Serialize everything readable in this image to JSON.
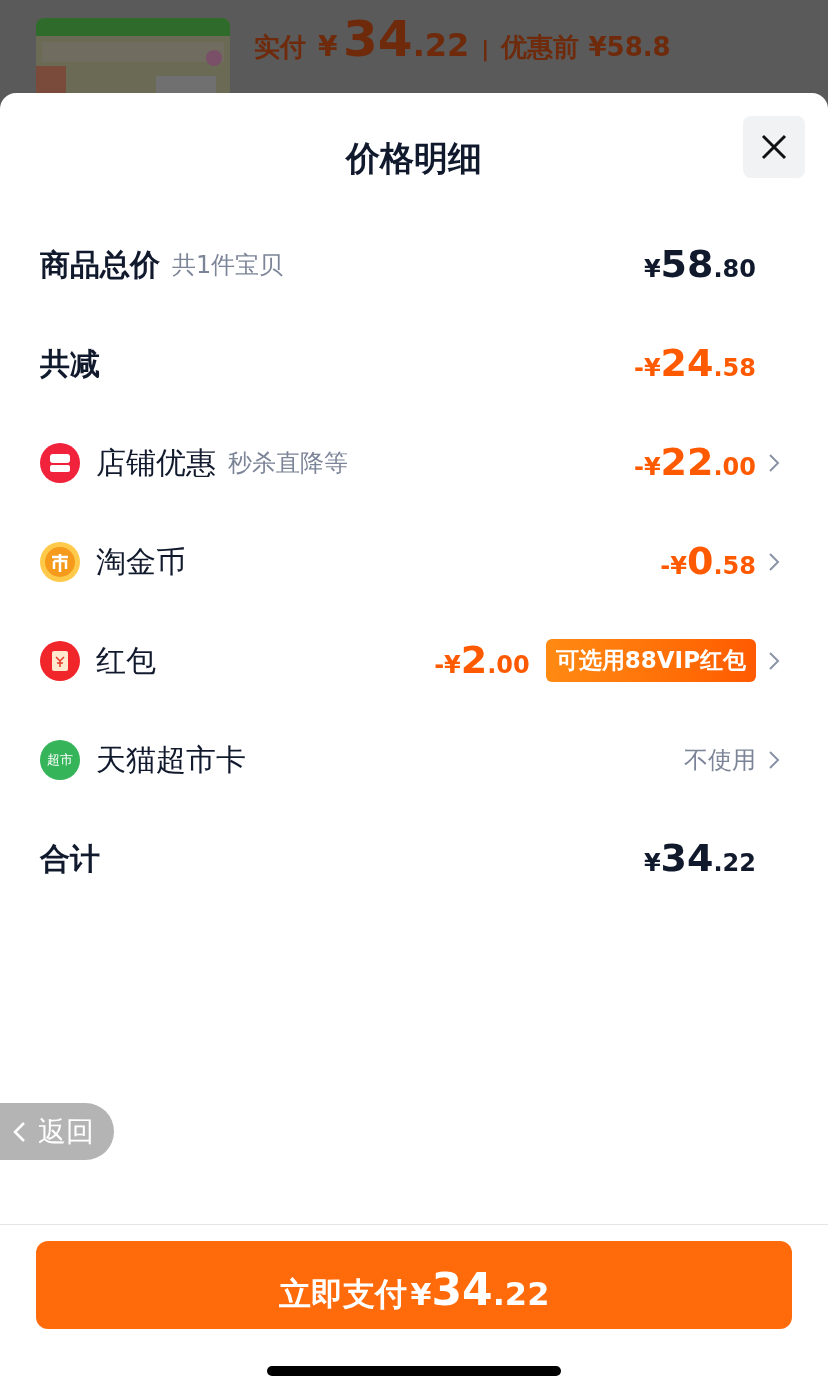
{
  "background": {
    "paid_label": "实付",
    "currency": "¥",
    "paid_int": "34",
    "paid_dec": ".22",
    "separator": "|",
    "original_label": "优惠前",
    "original_price": "¥58.8"
  },
  "sheet": {
    "title": "价格明细"
  },
  "rows": [
    {
      "kind": "subtotal",
      "label": "商品总价",
      "note": "共1件宝贝",
      "prefix": "¥",
      "int": "58",
      "dec": ".80"
    },
    {
      "kind": "reduction",
      "label": "共减",
      "prefix": "-¥",
      "int": "24",
      "dec": ".58"
    },
    {
      "kind": "shop",
      "label": "店铺优惠",
      "note": "秒杀直降等",
      "prefix": "-¥",
      "int": "22",
      "dec": ".00"
    },
    {
      "kind": "coin",
      "label": "淘金币",
      "prefix": "-¥",
      "int": "0",
      "dec": ".58"
    },
    {
      "kind": "envelope",
      "label": "红包",
      "prefix": "-¥",
      "int": "2",
      "dec": ".00",
      "tag": "可选用88VIP红包"
    },
    {
      "kind": "market",
      "icon_text": "超市",
      "label": "天猫超市卡",
      "status": "不使用"
    },
    {
      "kind": "subtotal",
      "label": "合计",
      "prefix": "¥",
      "int": "34",
      "dec": ".22"
    }
  ],
  "back_button": {
    "label": "返回"
  },
  "pay_button": {
    "label": "立即支付",
    "prefix": "¥",
    "int": "34",
    "dec": ".22"
  }
}
